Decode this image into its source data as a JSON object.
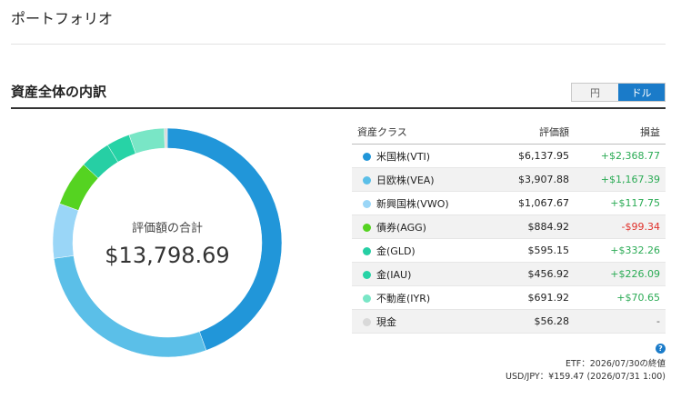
{
  "page": {
    "title": "ポートフォリオ"
  },
  "breakdown": {
    "title": "資産全体の内訳",
    "toggle": {
      "yen_label": "円",
      "usd_label": "ドル",
      "selected": "usd"
    },
    "total_label": "評価額の合計",
    "total_value": "$13,798.69",
    "table": {
      "headers": {
        "asset_class": "資産クラス",
        "value": "評価額",
        "pnl": "損益"
      },
      "rows": [
        {
          "name": "米国株(VTI)",
          "value": "$6,137.95",
          "pnl": "+$2,368.77",
          "pnl_sign": "gain",
          "color": "#2196d9"
        },
        {
          "name": "日欧株(VEA)",
          "value": "$3,907.88",
          "pnl": "+$1,167.39",
          "pnl_sign": "gain",
          "color": "#5bbfe8"
        },
        {
          "name": "新興国株(VWO)",
          "value": "$1,067.67",
          "pnl": "+$117.75",
          "pnl_sign": "gain",
          "color": "#9ad6f7"
        },
        {
          "name": "債券(AGG)",
          "value": "$884.92",
          "pnl": "-$99.34",
          "pnl_sign": "loss",
          "color": "#55d321"
        },
        {
          "name": "金(GLD)",
          "value": "$595.15",
          "pnl": "+$332.26",
          "pnl_sign": "gain",
          "color": "#26cfa4"
        },
        {
          "name": "金(IAU)",
          "value": "$456.92",
          "pnl": "+$226.09",
          "pnl_sign": "gain",
          "color": "#27d3a6"
        },
        {
          "name": "不動産(IYR)",
          "value": "$691.92",
          "pnl": "+$70.65",
          "pnl_sign": "gain",
          "color": "#79e6c6"
        },
        {
          "name": "現金",
          "value": "$56.28",
          "pnl": "-",
          "pnl_sign": "neutral",
          "color": "#d9d9d9"
        }
      ]
    },
    "donut_slices": [
      {
        "name": "米国株(VTI)",
        "value": 6137.95,
        "color": "#2196d9"
      },
      {
        "name": "日欧株(VEA)",
        "value": 3907.88,
        "color": "#5bbfe8"
      },
      {
        "name": "新興国株(VWO)",
        "value": 1067.67,
        "color": "#9ad6f7"
      },
      {
        "name": "債券(AGG)",
        "value": 884.92,
        "color": "#55d321"
      },
      {
        "name": "金(GLD)",
        "value": 595.15,
        "color": "#26cfa4"
      },
      {
        "name": "金(IAU)",
        "value": 456.92,
        "color": "#27d3a6"
      },
      {
        "name": "不動産(IYR)",
        "value": 691.92,
        "color": "#79e6c6"
      },
      {
        "name": "現金",
        "value": 56.28,
        "color": "#d9d9d9"
      }
    ],
    "footnotes": {
      "etf": "ETF：2026/07/30の終値",
      "fx": "USD/JPY：¥159.47 (2026/07/31 1:00)"
    },
    "info_icon": "info-icon"
  }
}
